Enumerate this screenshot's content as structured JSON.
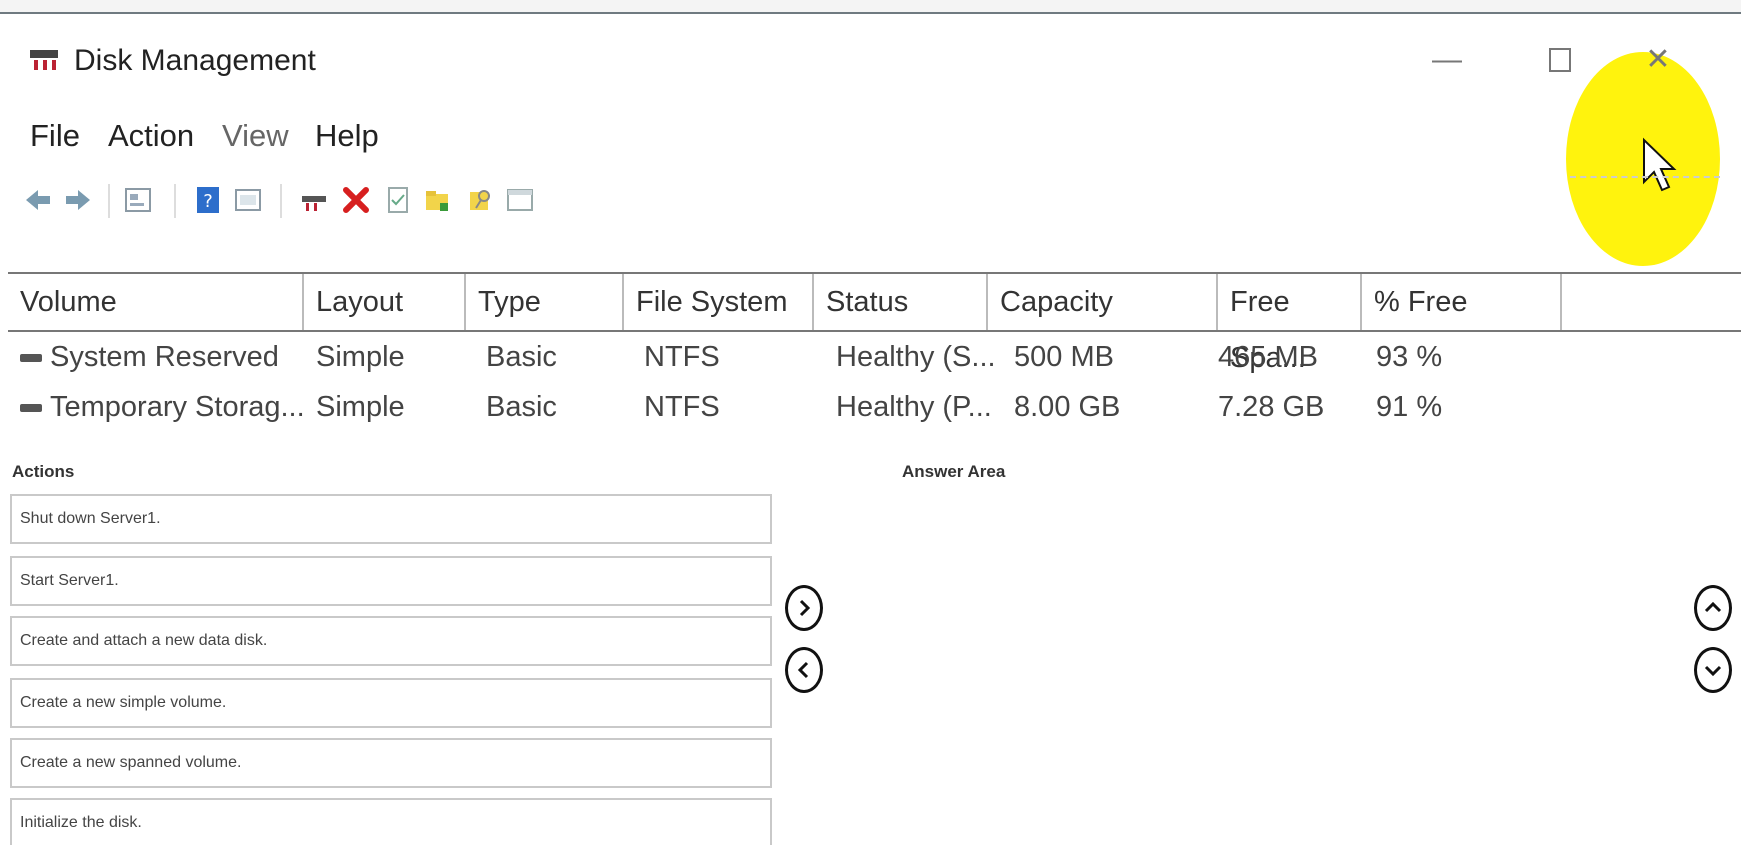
{
  "window": {
    "title": "Disk Management",
    "controls": [
      "minimize",
      "maximize",
      "close"
    ]
  },
  "menu": [
    "File",
    "Action",
    "View",
    "Help"
  ],
  "toolbar": {
    "icons": [
      "back-icon",
      "forward-icon",
      "properties-icon",
      "help-icon",
      "console-icon",
      "connect-disk-icon",
      "delete-icon",
      "checklist-icon",
      "folder-icon",
      "search-icon",
      "window-icon"
    ]
  },
  "table": {
    "columns": [
      "Volume",
      "Layout",
      "Type",
      "File System",
      "Status",
      "Capacity",
      "Free Spa...",
      "% Free"
    ],
    "rows": [
      [
        "System Reserved",
        "Simple",
        "Basic",
        "NTFS",
        "Healthy (S...",
        "500 MB",
        "465 MB",
        "93 %"
      ],
      [
        "Temporary Storag...",
        "Simple",
        "Basic",
        "NTFS",
        "Healthy (P...",
        "8.00 GB",
        "7.28 GB",
        "91 %"
      ]
    ]
  },
  "actions": {
    "label": "Actions",
    "items": [
      "Shut down Server1.",
      "Start Server1.",
      "Create and attach a new data disk.",
      "Create a new simple volume.",
      "Create a new spanned volume.",
      "Initialize the disk."
    ]
  },
  "answer_area": {
    "label": "Answer Area"
  },
  "colors": {
    "highlight": "#fff200",
    "delete_red": "#d71f1f"
  }
}
